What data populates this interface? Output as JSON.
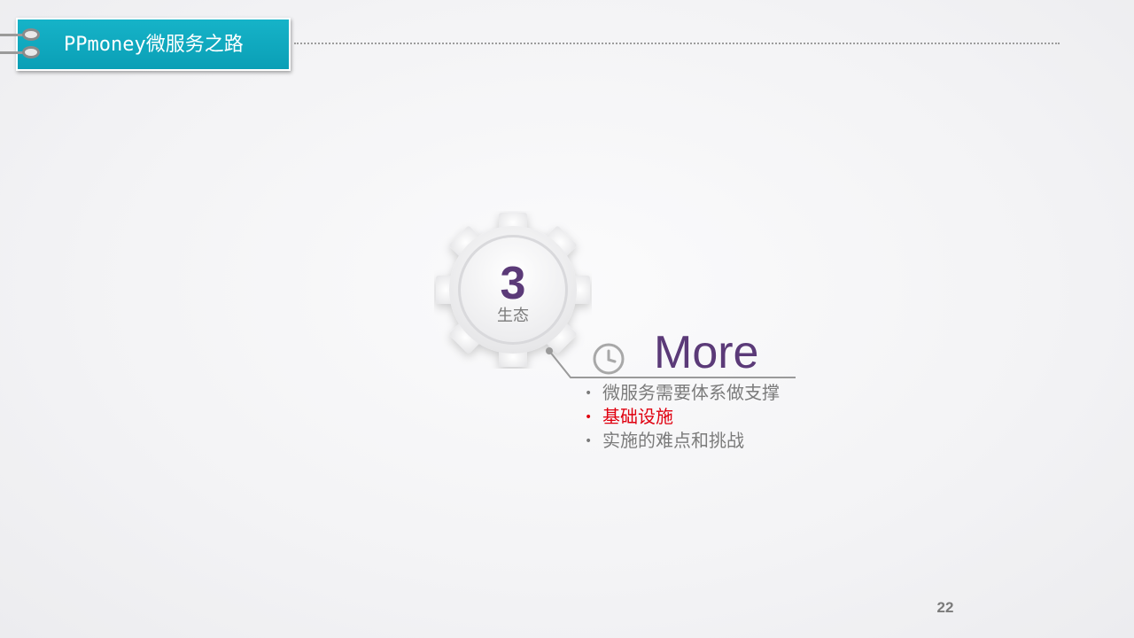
{
  "header": {
    "title_latin": "PPmoney",
    "title_cjk": "微服务之路"
  },
  "section": {
    "number": "3",
    "label": "生态"
  },
  "content": {
    "heading": "More",
    "items": [
      {
        "text": "微服务需要体系做支撑",
        "active": false
      },
      {
        "text": "基础设施",
        "active": true
      },
      {
        "text": "实施的难点和挑战",
        "active": false
      }
    ]
  },
  "footer": {
    "page_number": "22"
  },
  "colors": {
    "tab": "#0fa9bf",
    "accent_purple": "#5b3a78",
    "active_item": "#e0000f",
    "text_gray": "#7b7b7b"
  }
}
